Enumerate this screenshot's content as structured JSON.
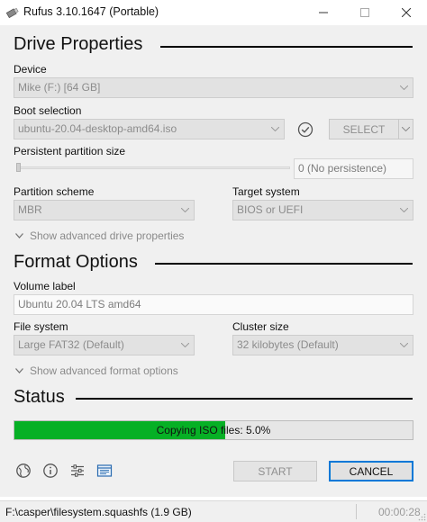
{
  "window": {
    "title": "Rufus 3.10.1647 (Portable)",
    "app_icon": "usb-drive-icon",
    "controls": [
      "minimize-icon",
      "maximize-icon",
      "close-icon"
    ]
  },
  "drive_properties": {
    "heading": "Drive Properties",
    "device_label": "Device",
    "device_value": "Mike (F:) [64 GB]",
    "boot_selection_label": "Boot selection",
    "boot_selection_value": "ubuntu-20.04-desktop-amd64.iso",
    "select_button": "SELECT",
    "persistent_label": "Persistent partition size",
    "persistent_value": "0 (No persistence)",
    "persistent_level": 0,
    "partition_scheme_label": "Partition scheme",
    "partition_scheme_value": "MBR",
    "target_system_label": "Target system",
    "target_system_value": "BIOS or UEFI",
    "advanced_toggle": "Show advanced drive properties"
  },
  "format_options": {
    "heading": "Format Options",
    "volume_label_label": "Volume label",
    "volume_label_value": "Ubuntu 20.04 LTS amd64",
    "file_system_label": "File system",
    "file_system_value": "Large FAT32 (Default)",
    "cluster_size_label": "Cluster size",
    "cluster_size_value": "32 kilobytes (Default)",
    "advanced_toggle": "Show advanced format options"
  },
  "status": {
    "heading": "Status",
    "progress_text": "Copying ISO files: 5.0%",
    "progress_fraction": 0.53,
    "accent_color": "#06b025"
  },
  "toolbar": {
    "icons": [
      "globe-icon",
      "info-icon",
      "settings-icon",
      "log-icon"
    ],
    "start_button": "START",
    "cancel_button": "CANCEL"
  },
  "statusbar": {
    "current_file": "F:\\casper\\filesystem.squashfs (1.9 GB)",
    "elapsed": "00:00:28"
  }
}
